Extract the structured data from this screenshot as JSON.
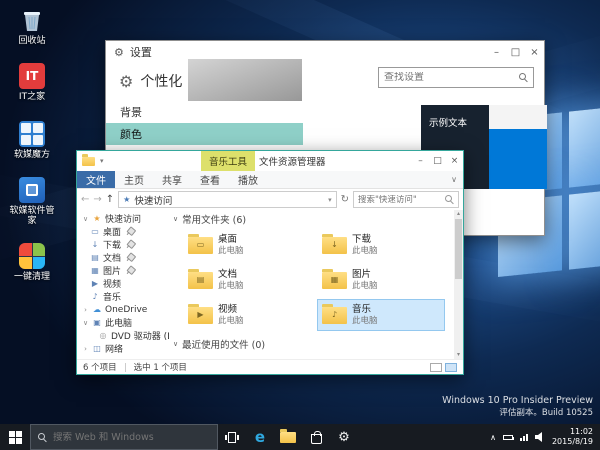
{
  "glyphs": {
    "minimize": "–",
    "maximize": "□",
    "close": "×",
    "back": "←",
    "forward": "→",
    "up": "↑",
    "refresh": "↻",
    "dropdown": "▾",
    "chevron_down": "∨",
    "chevron_right": "›",
    "chevron_up": "∧",
    "scroll_up": "▴",
    "scroll_down": "▾",
    "star": "★",
    "gear": "⚙",
    "edge": "e",
    "it_badge": "IT"
  },
  "desktop": {
    "icons": [
      {
        "label": "回收站"
      },
      {
        "label": "IT之家"
      },
      {
        "label": "软媒魔方"
      },
      {
        "label": "软媒软件管家"
      },
      {
        "label": "一键清理"
      }
    ],
    "watermark": {
      "line1": "Windows 10 Pro Insider Preview",
      "line2": "评估副本。Build 10525"
    }
  },
  "settings": {
    "window_title": "设置",
    "page_title": "个性化",
    "search_placeholder": "查找设置",
    "nav": [
      {
        "label": "背景"
      },
      {
        "label": "颜色"
      }
    ],
    "preview": {
      "sample_text": "示例文本"
    }
  },
  "explorer": {
    "contextual_tab": "音乐工具",
    "window_title": "文件资源管理器",
    "ribbon_tabs": [
      {
        "label": "文件"
      },
      {
        "label": "主页"
      },
      {
        "label": "共享"
      },
      {
        "label": "查看"
      },
      {
        "label": "播放"
      }
    ],
    "address": "快速访问",
    "search_placeholder": "搜索\"快速访问\"",
    "sidebar": [
      {
        "label": "快速访问",
        "icon": "★"
      },
      {
        "label": "桌面",
        "icon": "▭"
      },
      {
        "label": "下载",
        "icon": "↓"
      },
      {
        "label": "文档",
        "icon": "▤"
      },
      {
        "label": "图片",
        "icon": "▦"
      },
      {
        "label": "视频",
        "icon": "▶"
      },
      {
        "label": "音乐",
        "icon": "♪"
      },
      {
        "label": "OneDrive",
        "icon": "☁"
      },
      {
        "label": "此电脑",
        "icon": "▣"
      },
      {
        "label": "DVD 驱动器 (D:)",
        "icon": "◎"
      },
      {
        "label": "网络",
        "icon": "◫"
      }
    ],
    "sections": {
      "frequent": "常用文件夹 (6)",
      "recent": "最近使用的文件 (0)"
    },
    "folders": [
      {
        "name": "桌面",
        "location": "此电脑",
        "glyph": "▭"
      },
      {
        "name": "下载",
        "location": "此电脑",
        "glyph": "↓"
      },
      {
        "name": "文档",
        "location": "此电脑",
        "glyph": "▤"
      },
      {
        "name": "图片",
        "location": "此电脑",
        "glyph": "▦"
      },
      {
        "name": "视频",
        "location": "此电脑",
        "glyph": "▶"
      },
      {
        "name": "音乐",
        "location": "此电脑",
        "glyph": "♪"
      }
    ],
    "status": {
      "count": "6 个项目",
      "selected": "选中 1 个项目"
    }
  },
  "taskbar": {
    "search_placeholder": "搜索 Web 和 Windows",
    "clock": {
      "time": "11:02",
      "date": "2015/8/19"
    }
  }
}
